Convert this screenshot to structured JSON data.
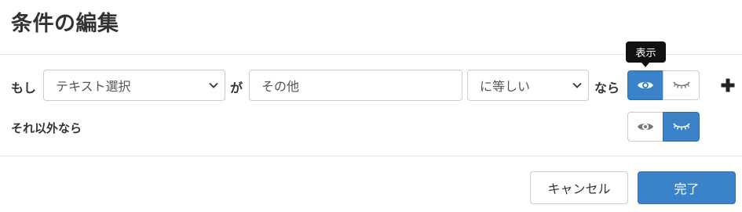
{
  "dialog": {
    "title": "条件の編集"
  },
  "condition": {
    "if_label": "もし",
    "field_select_value": "テキスト選択",
    "ga_label": "が",
    "value_input": "その他",
    "operator_select_value": "に等しい",
    "then_label": "なら",
    "tooltip": "表示",
    "show_selected": true
  },
  "else_row": {
    "label": "それ以外なら",
    "hide_selected": true
  },
  "footer": {
    "cancel_label": "キャンセル",
    "done_label": "完了"
  },
  "colors": {
    "accent": "#3a83c8",
    "icon_gray": "#777777",
    "icon_white": "#ffffff"
  }
}
